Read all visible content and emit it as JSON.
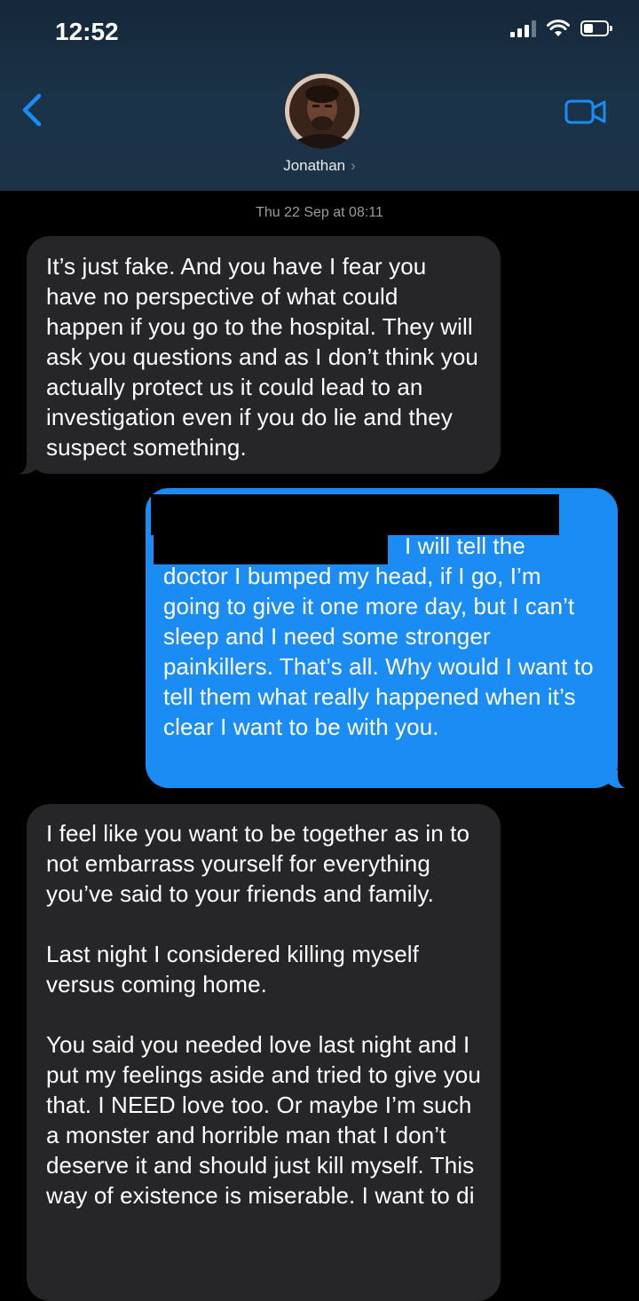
{
  "status_bar": {
    "time": "12:52"
  },
  "header": {
    "contact_name": "Jonathan",
    "contact_chevron": "›",
    "icons": {
      "back": "chevron-left-icon",
      "video": "video-camera-icon"
    }
  },
  "conversation": {
    "timestamp": "Thu 22 Sep at 08:11",
    "messages": [
      {
        "direction": "received",
        "text": "It’s just fake. And you have I fear you have no perspective of what could happen if you go to the hospital. They will ask you questions and as I don’t think you actually protect us it could lead to an investigation even if you do lie and they suspect something."
      },
      {
        "direction": "sent",
        "redacted_prefix": true,
        "first_fragment": "I will tell the",
        "text": "doctor I bumped my head, if I go, I’m going to give it one more day, but I can’t sleep and I need some stronger painkillers. That’s all. Why would I want to tell them what really happened when it’s clear I want to be with you."
      },
      {
        "direction": "received",
        "paragraphs": [
          "I feel like you want to be together as in to not embarrass yourself for everything you’ve said to your friends and family.",
          "Last night I considered killing myself versus coming home.",
          "You said you needed love last night and I put my feelings aside and tried to give you that. I NEED love too. Or maybe I’m such a monster and horrible man that I don’t deserve it and should just kill myself. This way of existence is miserable. I want to di"
        ]
      }
    ]
  },
  "colors": {
    "sent_bubble": "#1a8cf4",
    "received_bubble": "#262628",
    "background": "#000000",
    "accent": "#1a8cf4"
  }
}
